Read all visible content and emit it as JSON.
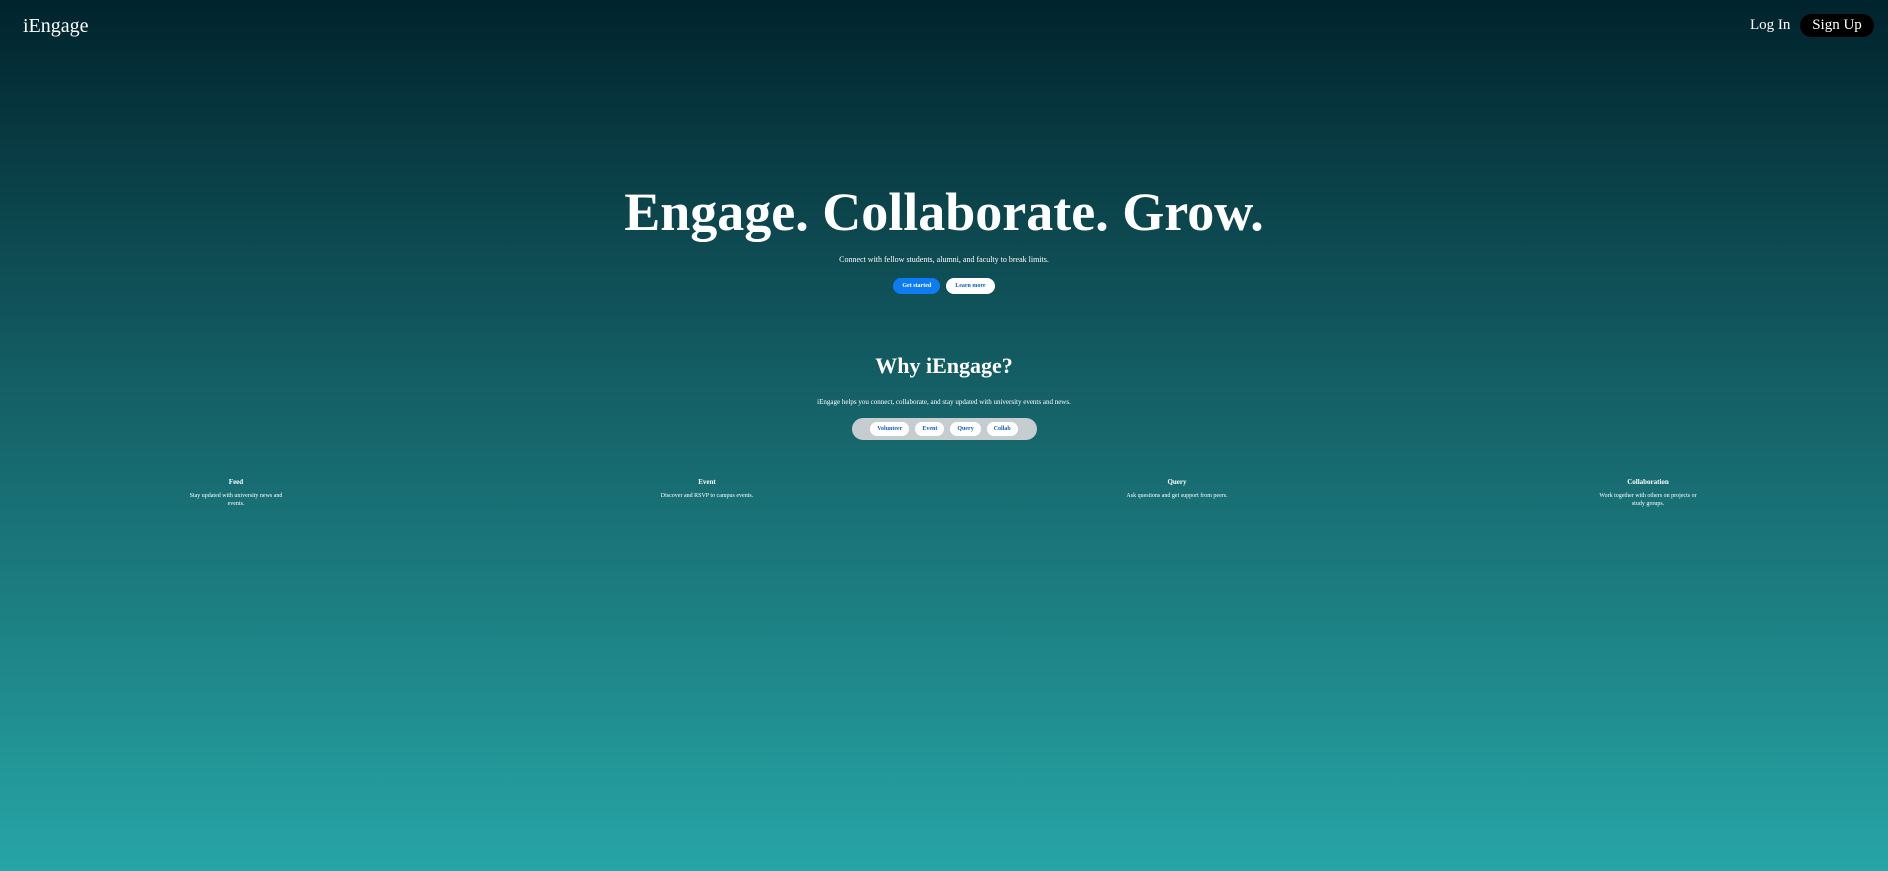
{
  "header": {
    "brand": "iEngage",
    "login_label": "Log In",
    "signup_label": "Sign Up"
  },
  "hero": {
    "title": "Engage. Collaborate. Grow.",
    "subtitle": "Connect with fellow students, alumni, and faculty to break limits.",
    "get_started_label": "Get started",
    "learn_more_label": "Learn more"
  },
  "why": {
    "title": "Why iEngage?",
    "description": "iEngage helps you connect, collaborate, and stay updated with university events and news.",
    "tabs": [
      "Volunteer",
      "Event",
      "Query",
      "Collab"
    ]
  },
  "features": [
    {
      "title": "Feed",
      "description": "Stay updated with university news and events."
    },
    {
      "title": "Event",
      "description": "Discover and RSVP to campus events."
    },
    {
      "title": "Query",
      "description": "Ask questions and get support from peers."
    },
    {
      "title": "Collaboration",
      "description": "Work together with others on projects or study groups."
    }
  ],
  "colors": {
    "primary_button": "#0d7cf2",
    "signup_button": "#000000",
    "gradient_top": "#00232d",
    "gradient_bottom": "#27a5a7"
  }
}
